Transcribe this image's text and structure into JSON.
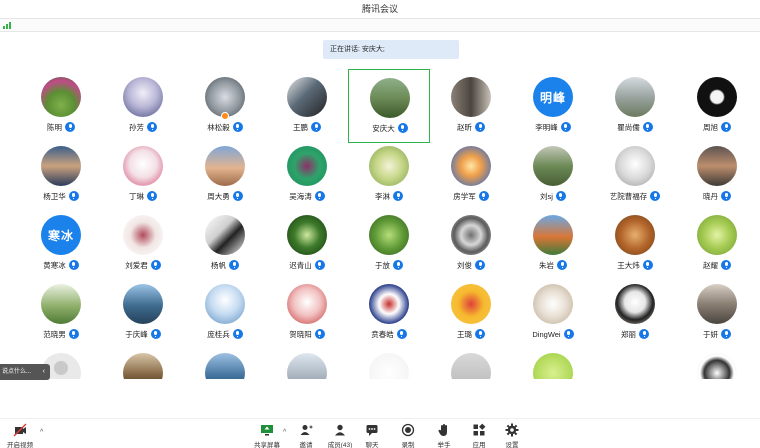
{
  "window": {
    "title": "腾讯会议"
  },
  "speaking": {
    "text": "正在讲话: 安庆大;"
  },
  "participants": [
    {
      "name": "陈明",
      "bg": "radial-gradient(circle at 50% 70%, #7fb04a 0%, #5b8f33 40%, #c04b88 70%, #3c6a2b 100%)",
      "icon": "photo-icon"
    },
    {
      "name": "孙芳",
      "bg": "radial-gradient(circle at 50% 40%, #f1eef8 0%, #b9b7d6 45%, #4a4f86 100%)",
      "icon": "photo-icon"
    },
    {
      "name": "林松毅",
      "bg": "radial-gradient(circle at 50% 50%, #d9dde2 0%, #8d959c 55%, #3f4449 100%)",
      "icon": "photo-icon",
      "badge": true
    },
    {
      "name": "王鹏",
      "bg": "linear-gradient(135deg, #e8e8e8 0%, #5b6a78 45%, #222 100%)",
      "icon": "photo-icon"
    },
    {
      "name": "安庆大",
      "bg": "linear-gradient(180deg, #8fb08a 0%, #6c8b57 50%, #3c5a2a 100%)",
      "icon": "photo-icon",
      "active": true
    },
    {
      "name": "赵昕",
      "bg": "linear-gradient(90deg, #8b8176 0%, #4b453f 50%, #c9c2b7 100%)",
      "icon": "photo-icon"
    },
    {
      "name": "李明峰",
      "bg": "#1a82ea",
      "text": "明峰",
      "icon": "text-avatar-icon"
    },
    {
      "name": "瞿尚儒",
      "bg": "linear-gradient(180deg, #d5dbe0 0%, #9aa4a0 50%, #6c7a5f 100%)",
      "icon": "photo-icon"
    },
    {
      "name": "周旭",
      "bg": "radial-gradient(circle at 50% 50%, #f4f4f4 0%, #f4f4f4 22%, #111 28%, #111 100%)",
      "icon": "photo-icon"
    },
    {
      "name": "杨卫华",
      "bg": "linear-gradient(180deg, #3b5f8a 0%, #caa27e 50%, #2a3b5c 100%)",
      "icon": "photo-icon"
    },
    {
      "name": "丁琳",
      "bg": "radial-gradient(circle at 50% 45%, #ffffff 0%, #f3e0e6 45%, #e49bb0 70%, #ffffff 100%)",
      "icon": "photo-icon"
    },
    {
      "name": "周大勇",
      "bg": "linear-gradient(180deg, #7fa6d6 0%, #e3b48f 55%, #9d6b4b 100%)",
      "icon": "photo-icon"
    },
    {
      "name": "吴海涛",
      "bg": "radial-gradient(circle at 50% 50%, #8f2f6a 0%, #2ea36a 45%, #1b8d5c 100%)",
      "icon": "photo-icon"
    },
    {
      "name": "李淋",
      "bg": "radial-gradient(circle at 50% 50%, #f4f2d8 0%, #c8d88a 45%, #7da04b 100%)",
      "icon": "photo-icon"
    },
    {
      "name": "房学军",
      "bg": "radial-gradient(circle at 50% 50%, #ffe6a6 0%, #f0a04a 35%, #6b79a3 75%, #2e3561 100%)",
      "icon": "photo-icon"
    },
    {
      "name": "刘sj",
      "bg": "linear-gradient(180deg, #c3c6b8 0%, #6d8a57 50%, #485e34 100%)",
      "icon": "photo-icon"
    },
    {
      "name": "艺院曹福存",
      "bg": "radial-gradient(circle at 50% 45%, #ffffff 0%, #d9d9d9 50%, #9a9a9a 100%)",
      "icon": "photo-icon"
    },
    {
      "name": "晓丹",
      "bg": "linear-gradient(180deg, #5d5450 0%, #bc8e6d 50%, #3f3a37 100%)",
      "icon": "photo-icon"
    },
    {
      "name": "黄寒冰",
      "bg": "#1a82ea",
      "text": "寒冰",
      "icon": "text-avatar-icon"
    },
    {
      "name": "刘爱君",
      "bg": "radial-gradient(circle at 50% 50%, #b24a5a 0%, #f0e6e4 45%, #ffffff 100%)",
      "icon": "photo-icon"
    },
    {
      "name": "杨帆",
      "bg": "linear-gradient(135deg, #ffffff 0%, #cfcfcf 40%, #222 60%, #f5f5f5 100%)",
      "icon": "photo-icon"
    },
    {
      "name": "迟青山",
      "bg": "radial-gradient(circle at 50% 50%, #d0e8a0 0%, #3d7a2a 45%, #173a12 100%)",
      "icon": "photo-icon"
    },
    {
      "name": "于放",
      "bg": "radial-gradient(circle at 50% 50%, #b6de7a 0%, #5f9a37 50%, #2e5a1a 100%)",
      "icon": "photo-icon"
    },
    {
      "name": "刘俊",
      "bg": "radial-gradient(circle at 50% 50%, #6f6f6f 0%, #d7d7d7 35%, #5c5c5c 60%, #cfcfcf 100%)",
      "icon": "photo-icon"
    },
    {
      "name": "朱岩",
      "bg": "linear-gradient(180deg, #6aa8e4 0%, #d97636 55%, #3f7b3a 100%)",
      "icon": "photo-icon"
    },
    {
      "name": "王大炜",
      "bg": "radial-gradient(circle at 50% 50%, #e6b070 0%, #b3652a 50%, #6b3d18 100%)",
      "icon": "photo-icon"
    },
    {
      "name": "赵耀",
      "bg": "radial-gradient(circle at 50% 50%, #e4f2a6 0%, #a8cd56 45%, #6e9a2c 100%)",
      "icon": "photo-icon"
    },
    {
      "name": "范晓男",
      "bg": "linear-gradient(180deg, #eaf0e2 0%, #8fb06b 55%, #4f7a35 100%)",
      "icon": "photo-icon"
    },
    {
      "name": "于庆峰",
      "bg": "linear-gradient(180deg, #9cc4e6 0%, #3d6a8d 55%, #26425c 100%)",
      "icon": "photo-icon"
    },
    {
      "name": "庞桂兵",
      "bg": "radial-gradient(circle at 50% 40%, #ffffff 0%, #c6dcf2 45%, #5f8fbf 100%)",
      "icon": "photo-icon"
    },
    {
      "name": "贺晓阳",
      "bg": "radial-gradient(circle at 50% 45%, #ffffff 0%, #f2c2c2 45%, #c43838 100%)",
      "icon": "photo-icon"
    },
    {
      "name": "贲春皓",
      "bg": "radial-gradient(circle at 50% 50%, #c32f2f 0%, #ffffff 35%, #2b3e8c 70%, #ffffff 100%)",
      "icon": "photo-icon"
    },
    {
      "name": "王璐",
      "bg": "radial-gradient(circle at 50% 50%, #e0403a 0%, #f6b92e 45%, #f7c84a 100%)",
      "icon": "photo-icon"
    },
    {
      "name": "DingWei",
      "bg": "radial-gradient(circle at 50% 50%, #ffffff 0%, #e8e0d4 45%, #b9a88f 100%)",
      "icon": "photo-icon"
    },
    {
      "name": "郑丽",
      "bg": "radial-gradient(circle at 50% 45%, #ffffff 0%, #e6e6e6 35%, #222 60%, #d4c9b8 100%)",
      "icon": "photo-icon"
    },
    {
      "name": "于妍",
      "bg": "linear-gradient(180deg, #d9cfc5 0%, #8a7f73 50%, #4a4540 100%)",
      "icon": "photo-icon"
    },
    {
      "name": "",
      "bg": "#e9e9e9",
      "icon": "default-user-icon"
    },
    {
      "name": "",
      "bg": "linear-gradient(180deg, #d9c7a8 0%, #7a5d3a 60%, #3a2a18 100%)",
      "icon": "photo-icon"
    },
    {
      "name": "",
      "bg": "linear-gradient(180deg, #9ec1e2 0%, #3f6f9a 60%, #2c4c6a 100%)",
      "icon": "photo-icon"
    },
    {
      "name": "",
      "bg": "linear-gradient(180deg, #dfe7ef 0%, #a7b3be 60%, #6d7781 100%)",
      "icon": "photo-icon"
    },
    {
      "name": "",
      "bg": "radial-gradient(circle at 50% 50%, #ffffff 0%, #f1f1f1 100%)",
      "icon": "photo-icon"
    },
    {
      "name": "",
      "bg": "linear-gradient(180deg, #d9d9d9 0%, #b5b5b5 100%)",
      "icon": "photo-icon"
    },
    {
      "name": "",
      "bg": "radial-gradient(circle at 50% 50%, #d8f08f 0%, #9ccc3c 100%)",
      "icon": "photo-icon"
    },
    {
      "name": "",
      "bg": "#ffffff",
      "icon": "photo-icon"
    },
    {
      "name": "",
      "bg": "radial-gradient(circle at 50% 50%, #ffffff 0%, #333 45%, #ffffff 60%, #e8e8e8 100%)",
      "icon": "photo-icon"
    }
  ],
  "chat_hint": {
    "text": "说点什么...",
    "chevron": "‹"
  },
  "toolbar": {
    "video_label": "开启视频",
    "share_label": "共享屏幕",
    "invite_label": "邀请",
    "members_label": "成员(43)",
    "chat_label": "聊天",
    "record_label": "录制",
    "raise_label": "举手",
    "apps_label": "应用",
    "settings_label": "设置"
  },
  "colors": {
    "mic": "#1677e8",
    "active_border": "#2fb34b",
    "speaker_bg": "#dfeaf8",
    "text_avatar": "#1a82ea"
  }
}
